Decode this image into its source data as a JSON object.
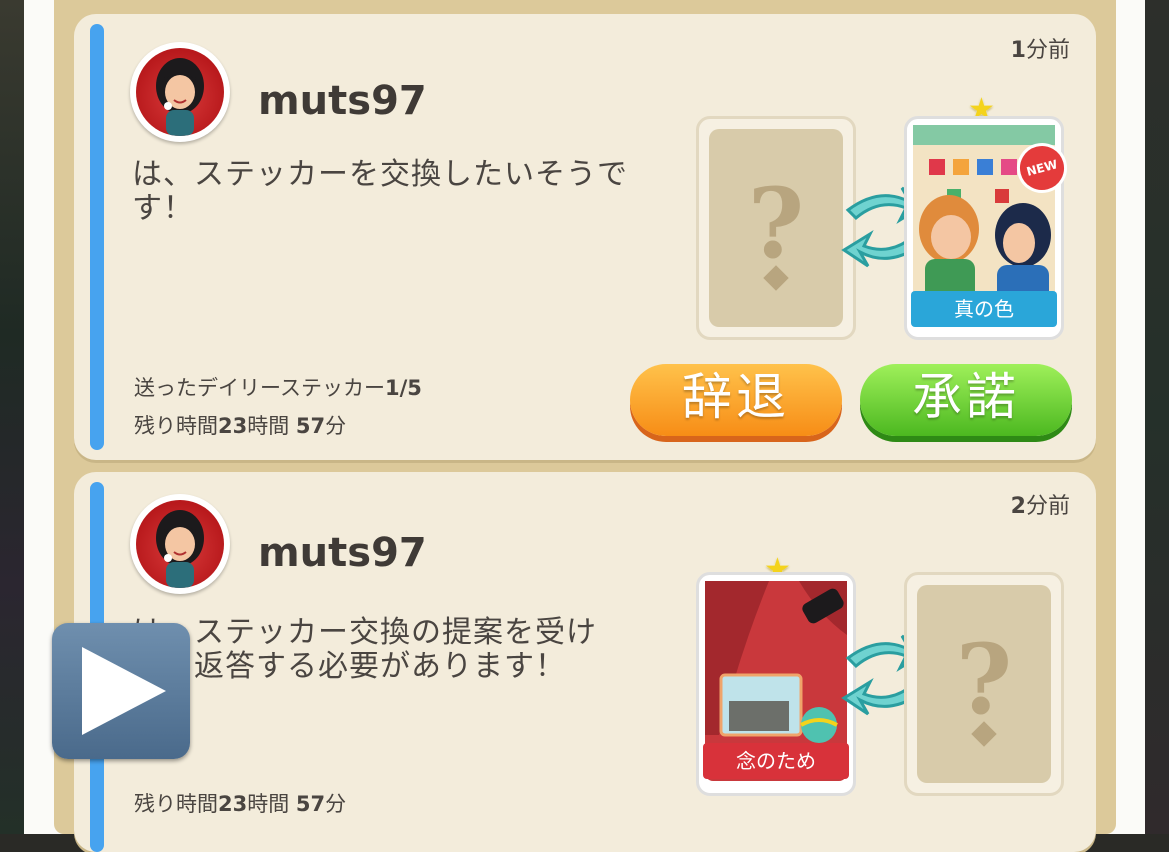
{
  "notifications": [
    {
      "time_number": "1",
      "time_unit": "分前",
      "username": "muts97",
      "message": "は、ステッカーを交換したいそうです！",
      "daily_label": "送ったデイリーステッカー",
      "daily_count": "1/5",
      "remaining_prefix": "残り時間",
      "remaining_hours": "23",
      "remaining_hours_unit": "時間",
      "remaining_minutes": "57",
      "remaining_minutes_unit": "分",
      "card_name": "真の色",
      "new_badge": "NEW",
      "decline_label": "辞退",
      "accept_label": "承諾"
    },
    {
      "time_number": "2",
      "time_unit": "分前",
      "username": "muts97",
      "message_line1": "は、ステッカー交換の提案を受け",
      "message_line2": "た、返答する必要があります！",
      "remaining_prefix": "残り時間",
      "remaining_hours": "23",
      "remaining_hours_unit": "時間",
      "remaining_minutes": "57",
      "remaining_minutes_unit": "分",
      "card_name": "念のため"
    }
  ],
  "icons": {
    "question_mark": "?",
    "star": "★",
    "play": "play-icon"
  },
  "colors": {
    "accent_strip": "#47a3ef",
    "decline": "#f78d16",
    "accept": "#4cb820",
    "panel": "#f3ecdb",
    "board": "#dcc99a"
  }
}
